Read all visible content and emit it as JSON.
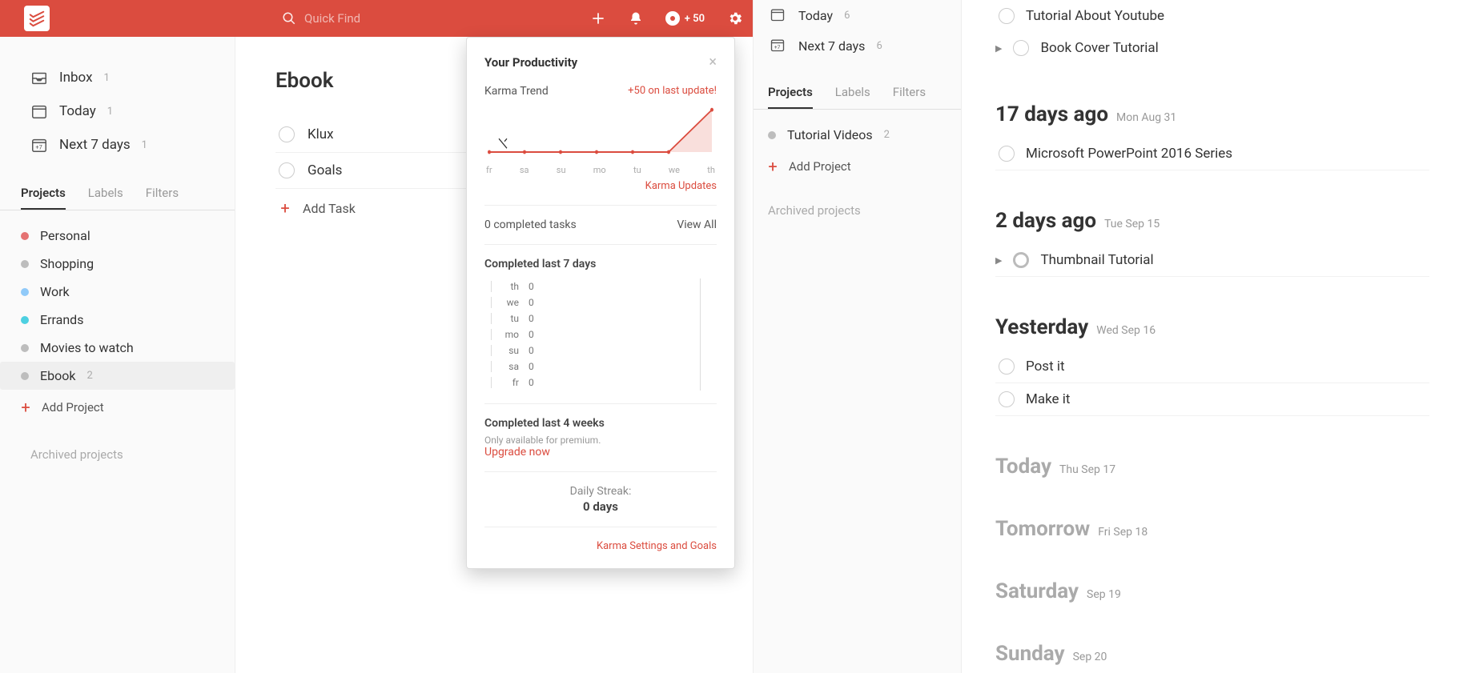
{
  "topbar": {
    "search_placeholder": "Quick Find",
    "karma_delta": "+ 50"
  },
  "sidebar1": {
    "inbox": {
      "label": "Inbox",
      "count": "1"
    },
    "today": {
      "label": "Today",
      "count": "1"
    },
    "next7": {
      "label": "Next 7 days",
      "count": "1"
    },
    "tabs": {
      "projects": "Projects",
      "labels": "Labels",
      "filters": "Filters"
    },
    "projects": [
      {
        "label": "Personal",
        "color": "#e57373",
        "count": ""
      },
      {
        "label": "Shopping",
        "color": "#bdbdbd",
        "count": ""
      },
      {
        "label": "Work",
        "color": "#90caf9",
        "count": ""
      },
      {
        "label": "Errands",
        "color": "#4dd0e1",
        "count": ""
      },
      {
        "label": "Movies to watch",
        "color": "#bdbdbd",
        "count": ""
      },
      {
        "label": "Ebook",
        "color": "#bdbdbd",
        "count": "2"
      }
    ],
    "add_project": "Add Project",
    "archived": "Archived projects"
  },
  "main1": {
    "title": "Ebook",
    "tasks": [
      {
        "label": "Klux"
      },
      {
        "label": "Goals"
      }
    ],
    "add_task": "Add Task"
  },
  "panel": {
    "title": "Your Productivity",
    "karma_trend": "Karma Trend",
    "last_update": "+50 on last update!",
    "karma_updates": "Karma Updates",
    "completed_tasks": "0 completed tasks",
    "view_all": "View All",
    "last7_title": "Completed last 7 days",
    "days": [
      {
        "d": "th",
        "v": "0"
      },
      {
        "d": "we",
        "v": "0"
      },
      {
        "d": "tu",
        "v": "0"
      },
      {
        "d": "mo",
        "v": "0"
      },
      {
        "d": "su",
        "v": "0"
      },
      {
        "d": "sa",
        "v": "0"
      },
      {
        "d": "fr",
        "v": "0"
      }
    ],
    "last4_title": "Completed last 4 weeks",
    "premium_note": "Only available for premium.",
    "upgrade": "Upgrade now",
    "daily_streak_label": "Daily Streak:",
    "daily_streak_value": "0 days",
    "karma_settings": "Karma Settings and Goals",
    "chart_x": [
      "fr",
      "sa",
      "su",
      "mo",
      "tu",
      "we",
      "th"
    ]
  },
  "chart_data": {
    "type": "line",
    "x": [
      "fr",
      "sa",
      "su",
      "mo",
      "tu",
      "we",
      "th"
    ],
    "values": [
      0,
      0,
      0,
      0,
      0,
      0,
      50
    ],
    "title": "Karma Trend",
    "annotation": "+50 on last update!",
    "ylim": [
      0,
      60
    ]
  },
  "sidebar2": {
    "today": {
      "label": "Today",
      "count": "6"
    },
    "next7": {
      "label": "Next 7 days",
      "count": "6"
    },
    "tabs": {
      "projects": "Projects",
      "labels": "Labels",
      "filters": "Filters"
    },
    "projects": [
      {
        "label": "Tutorial Videos",
        "color": "#bdbdbd",
        "count": "2"
      }
    ],
    "add_project": "Add Project",
    "archived": "Archived projects"
  },
  "main2": {
    "top_tasks": [
      {
        "label": "Tutorial About Youtube",
        "chevron": false
      },
      {
        "label": "Book Cover Tutorial",
        "chevron": true
      }
    ],
    "sections": [
      {
        "title": "17 days ago",
        "subtitle": "Mon Aug 31",
        "muted": false,
        "tasks": [
          {
            "label": "Microsoft PowerPoint 2016 Series",
            "chevron": false,
            "highlight": false
          }
        ]
      },
      {
        "title": "2 days ago",
        "subtitle": "Tue Sep 15",
        "muted": false,
        "tasks": [
          {
            "label": "Thumbnail Tutorial",
            "chevron": true,
            "highlight": true
          }
        ]
      },
      {
        "title": "Yesterday",
        "subtitle": "Wed Sep 16",
        "muted": false,
        "tasks": [
          {
            "label": "Post it",
            "chevron": false,
            "highlight": false
          },
          {
            "label": "Make it",
            "chevron": false,
            "highlight": false
          }
        ]
      },
      {
        "title": "Today",
        "subtitle": "Thu Sep 17",
        "muted": true,
        "tasks": []
      },
      {
        "title": "Tomorrow",
        "subtitle": "Fri Sep 18",
        "muted": true,
        "tasks": []
      },
      {
        "title": "Saturday",
        "subtitle": "Sep 19",
        "muted": true,
        "tasks": []
      },
      {
        "title": "Sunday",
        "subtitle": "Sep 20",
        "muted": true,
        "tasks": []
      }
    ]
  }
}
